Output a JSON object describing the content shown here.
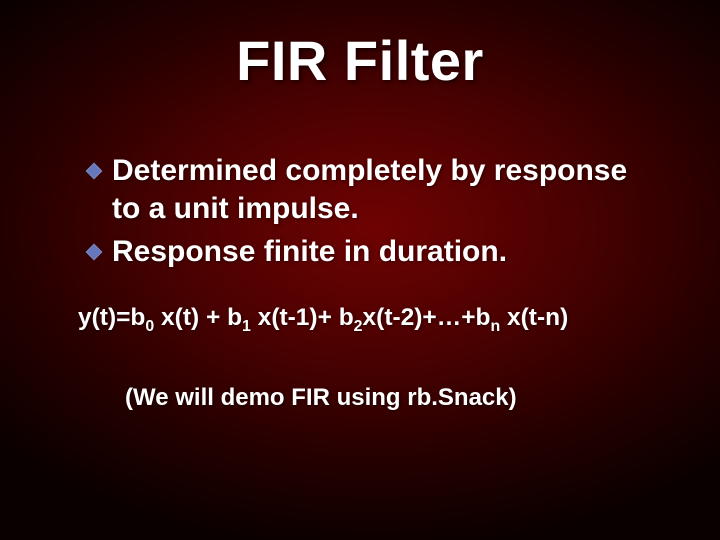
{
  "title": "FIR Filter",
  "bullets": [
    {
      "text": "Determined completely by response to a unit impulse."
    },
    {
      "text": "Response finite in duration."
    }
  ],
  "equation": {
    "plain": "y(t)=b₀ x(t) + b₁ x(t-1)+ b₂x(t-2)+…+bₙ x(t-n)",
    "parts": [
      {
        "t": "y(t)=b"
      },
      {
        "sub": "0"
      },
      {
        "t": " x(t) + b"
      },
      {
        "sub": "1"
      },
      {
        "t": " x(t-1)+ b"
      },
      {
        "sub": "2"
      },
      {
        "t": "x(t-2)+…+b"
      },
      {
        "sub": "n"
      },
      {
        "t": " x(t-n)"
      }
    ]
  },
  "note": "(We will demo FIR using rb.Snack)"
}
